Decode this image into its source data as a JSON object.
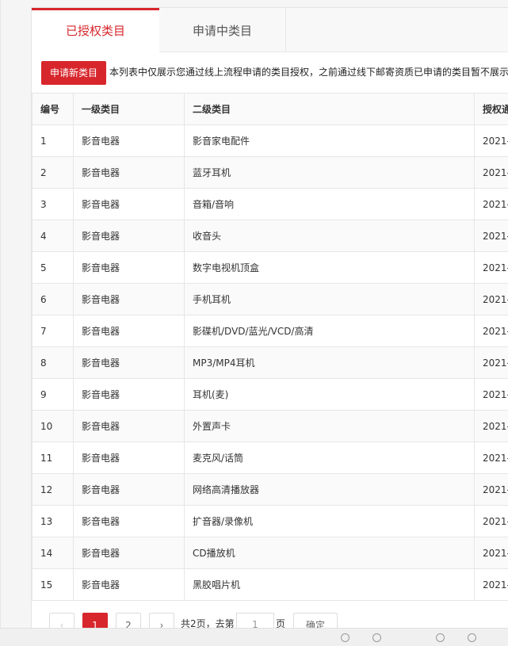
{
  "tabs": [
    {
      "label": "已授权类目",
      "active": true
    },
    {
      "label": "申请中类目",
      "active": false
    }
  ],
  "toolbar": {
    "apply_label": "申请新类目",
    "notice": "本列表中仅展示您通过线上流程申请的类目授权，之前通过线下邮寄资质已申请的类目暂不展示"
  },
  "table": {
    "headers": [
      "编号",
      "一级类目",
      "二级类目",
      "授权通"
    ],
    "rows": [
      [
        "1",
        "影音电器",
        "影音家电配件",
        "2021-"
      ],
      [
        "2",
        "影音电器",
        "蓝牙耳机",
        "2021-"
      ],
      [
        "3",
        "影音电器",
        "音箱/音响",
        "2021-"
      ],
      [
        "4",
        "影音电器",
        "收音头",
        "2021-"
      ],
      [
        "5",
        "影音电器",
        "数字电视机顶盒",
        "2021-"
      ],
      [
        "6",
        "影音电器",
        "手机耳机",
        "2021-"
      ],
      [
        "7",
        "影音电器",
        "影碟机/DVD/蓝光/VCD/高清",
        "2021-"
      ],
      [
        "8",
        "影音电器",
        "MP3/MP4耳机",
        "2021-"
      ],
      [
        "9",
        "影音电器",
        "耳机(麦)",
        "2021-"
      ],
      [
        "10",
        "影音电器",
        "外置声卡",
        "2021-"
      ],
      [
        "11",
        "影音电器",
        "麦克风/话筒",
        "2021-"
      ],
      [
        "12",
        "影音电器",
        "网络高清播放器",
        "2021-"
      ],
      [
        "13",
        "影音电器",
        "扩音器/录像机",
        "2021-"
      ],
      [
        "14",
        "影音电器",
        "CD播放机",
        "2021-"
      ],
      [
        "15",
        "影音电器",
        "黑胶唱片机",
        "2021-"
      ]
    ]
  },
  "pagination": {
    "prev": "‹",
    "pages": [
      "1",
      "2"
    ],
    "current": "1",
    "next": "›",
    "total_text": "共2页，去第",
    "page_input": "1",
    "page_suffix": "页",
    "confirm_label": "确定"
  },
  "colors": {
    "accent": "#d7262c"
  },
  "icons": [
    "chevron-left-icon",
    "chevron-right-icon",
    "status-icon"
  ]
}
